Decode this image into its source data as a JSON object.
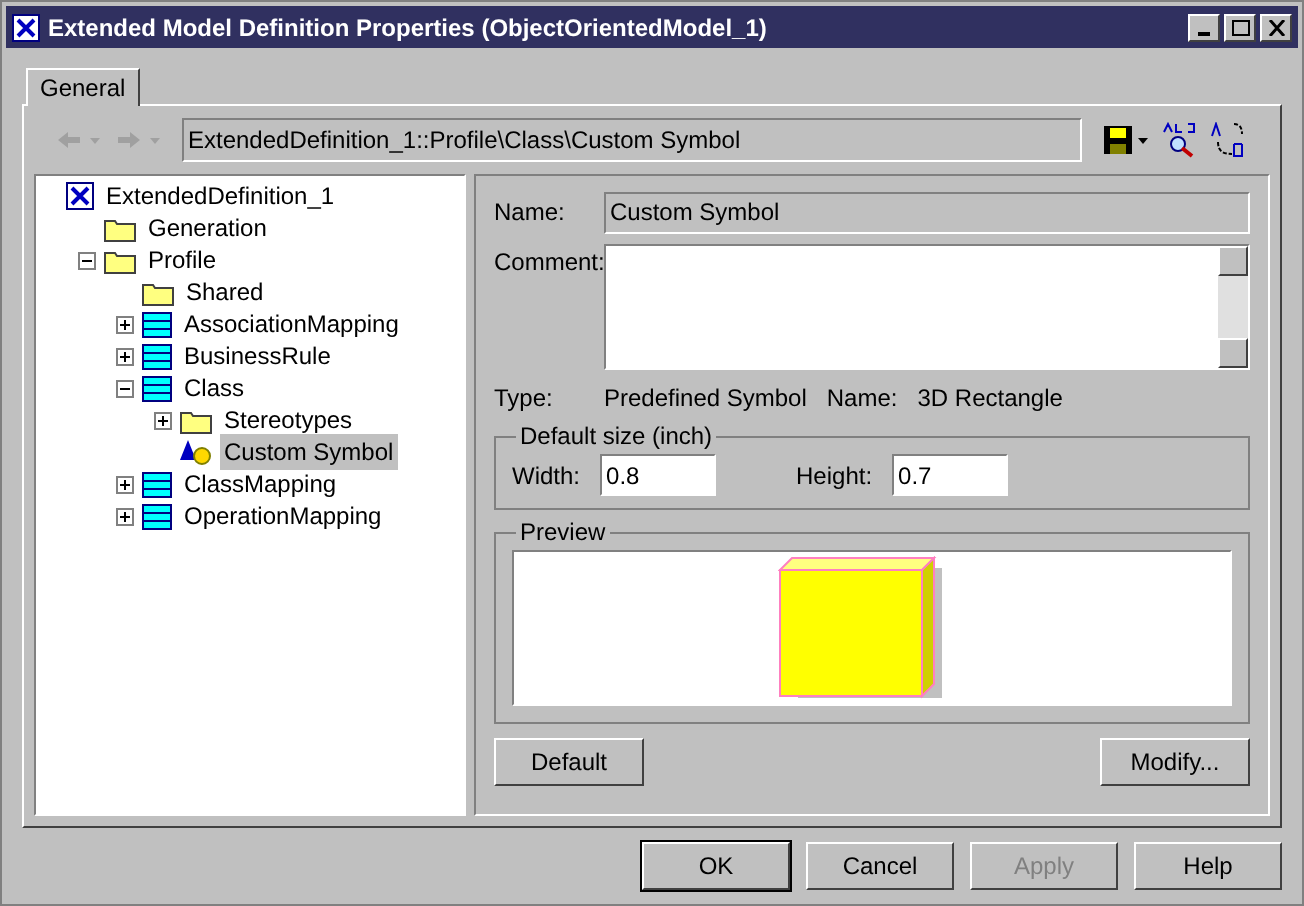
{
  "window": {
    "title": "Extended Model Definition Properties (ObjectOrientedModel_1)"
  },
  "tabs": [
    {
      "label": "General",
      "selected": true
    }
  ],
  "toolbar": {
    "path": "ExtendedDefinition_1::Profile\\Class\\Custom Symbol",
    "back_disabled": true,
    "forward_disabled": true
  },
  "tree": [
    {
      "label": "ExtendedDefinition_1",
      "kind": "root",
      "selected": false,
      "children": [
        {
          "label": "Generation",
          "kind": "folder",
          "selected": false
        },
        {
          "label": "Profile",
          "kind": "folder",
          "selected": false,
          "expanded": true,
          "children": [
            {
              "label": "Shared",
              "kind": "folder",
              "selected": false
            },
            {
              "label": "AssociationMapping",
              "kind": "metaclass",
              "selected": false,
              "expanded": false
            },
            {
              "label": "BusinessRule",
              "kind": "metaclass",
              "selected": false,
              "expanded": false
            },
            {
              "label": "Class",
              "kind": "metaclass",
              "selected": false,
              "expanded": true,
              "children": [
                {
                  "label": "Stereotypes",
                  "kind": "folder",
                  "selected": false,
                  "expanded": false
                },
                {
                  "label": "Custom Symbol",
                  "kind": "symbol",
                  "selected": true
                }
              ]
            },
            {
              "label": "ClassMapping",
              "kind": "metaclass",
              "selected": false,
              "expanded": false
            },
            {
              "label": "OperationMapping",
              "kind": "metaclass",
              "selected": false,
              "expanded": false
            }
          ]
        }
      ]
    }
  ],
  "form": {
    "name_label": "Name:",
    "name_value": "Custom Symbol",
    "comment_label": "Comment:",
    "type_label": "Type:",
    "type_value": "Predefined Symbol",
    "symbol_name_label": "Name:",
    "symbol_name_value": "3D Rectangle",
    "size_group": "Default size (inch)",
    "width_label": "Width:",
    "width_value": "0.8",
    "height_label": "Height:",
    "height_value": "0.7",
    "preview_group": "Preview",
    "default_button": "Default",
    "modify_button": "Modify..."
  },
  "buttons": [
    {
      "label": "OK",
      "disabled": false,
      "default": true
    },
    {
      "label": "Cancel",
      "disabled": false,
      "default": false
    },
    {
      "label": "Apply",
      "disabled": true,
      "default": false
    },
    {
      "label": "Help",
      "disabled": false,
      "default": false
    }
  ]
}
